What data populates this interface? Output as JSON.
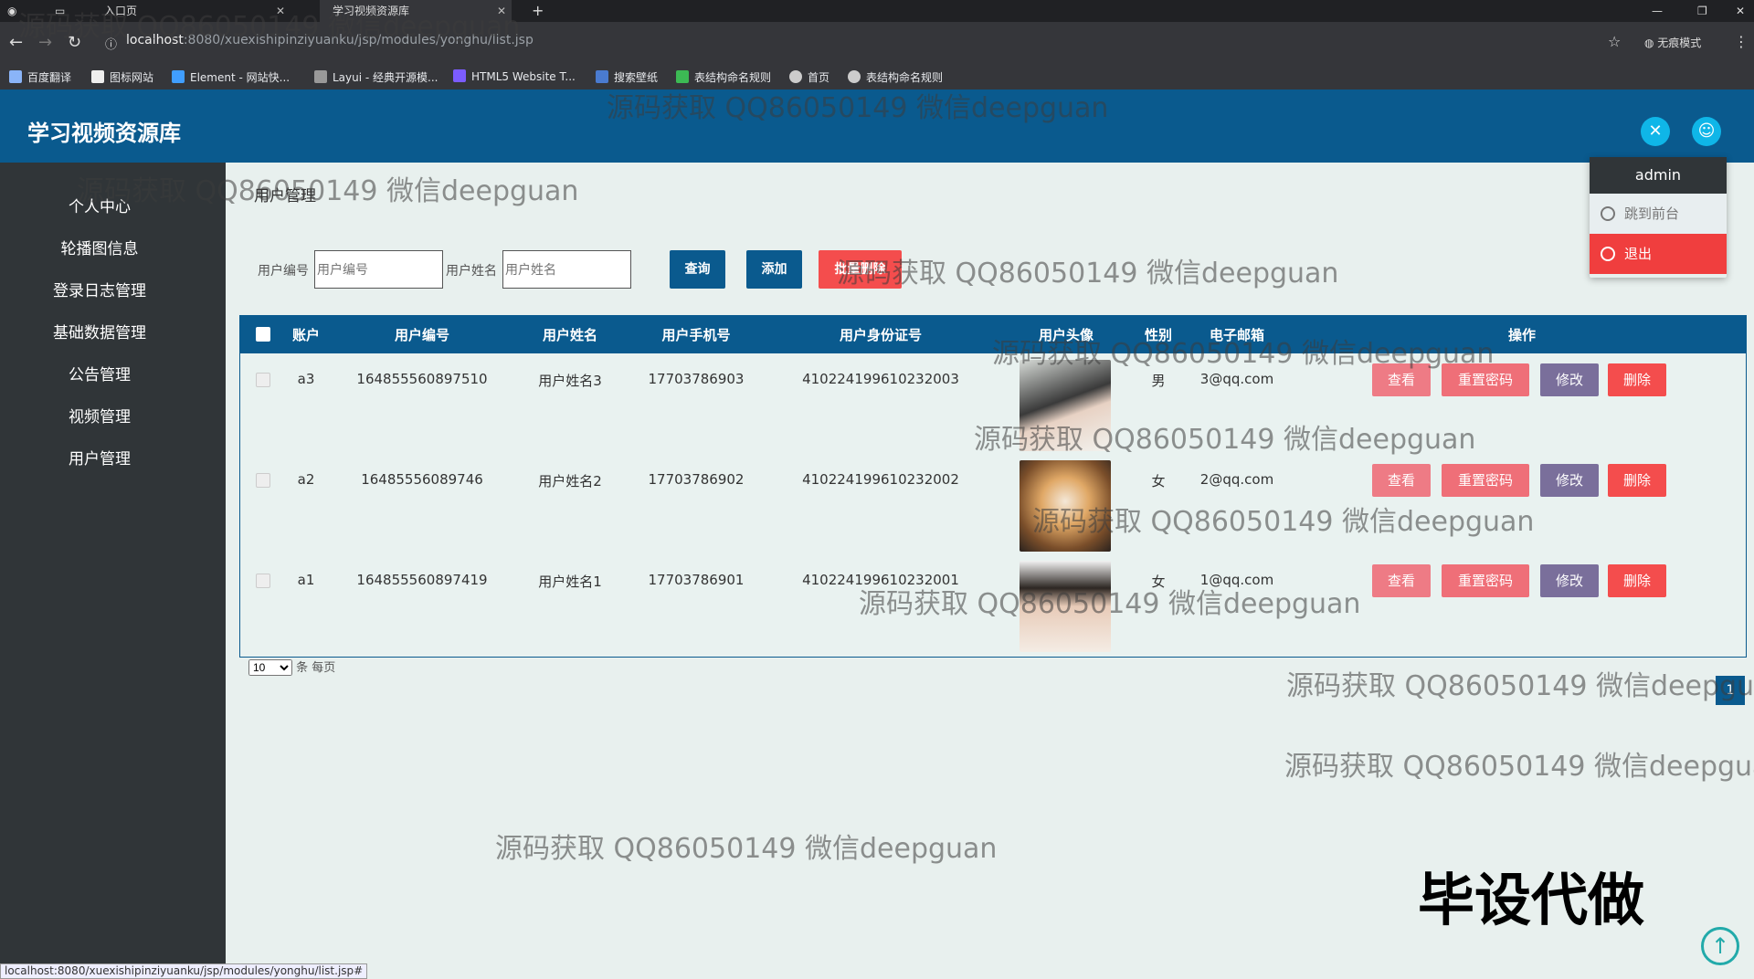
{
  "browser": {
    "tabs": [
      {
        "label": "入口页"
      },
      {
        "label": "学习视频资源库"
      }
    ],
    "new_tab": "+",
    "url_host": "localhost",
    "url_path": ":8080/xuexishipinziyuanku/jsp/modules/yonghu/list.jsp",
    "incognito_label": "无痕模式",
    "bookmarks": [
      "百度翻译",
      "图标网站",
      "Element - 网站快...",
      "Layui - 经典开源模...",
      "HTML5 Website T...",
      "搜索壁纸",
      "表结构命名规则",
      "首页",
      "表结构命名规则"
    ]
  },
  "header": {
    "title": "学习视频资源库"
  },
  "sidebar": {
    "items": [
      {
        "label": "个人中心"
      },
      {
        "label": "轮播图信息"
      },
      {
        "label": "登录日志管理"
      },
      {
        "label": "基础数据管理"
      },
      {
        "label": "公告管理"
      },
      {
        "label": "视频管理"
      },
      {
        "label": "用户管理"
      }
    ]
  },
  "page": {
    "breadcrumb": "用户管理"
  },
  "filter": {
    "user_no_label": "用户编号",
    "user_no_placeholder": "用户编号",
    "user_name_label": "用户姓名",
    "user_name_placeholder": "用户姓名",
    "query_button": "查询",
    "add_button": "添加",
    "batch_delete_button": "批量删除"
  },
  "table": {
    "headers": [
      "账户",
      "用户编号",
      "用户姓名",
      "用户手机号",
      "用户身份证号",
      "用户头像",
      "性别",
      "电子邮箱",
      "操作"
    ],
    "rows": [
      {
        "account": "a3",
        "user_no": "164855560897510",
        "name": "用户姓名3",
        "phone": "17703786903",
        "id_card": "410224199610232003",
        "gender": "男",
        "email": "3@qq.com"
      },
      {
        "account": "a2",
        "user_no": "16485556089746",
        "name": "用户姓名2",
        "phone": "17703786902",
        "id_card": "410224199610232002",
        "gender": "女",
        "email": "2@qq.com"
      },
      {
        "account": "a1",
        "user_no": "164855560897419",
        "name": "用户姓名1",
        "phone": "17703786901",
        "id_card": "410224199610232001",
        "gender": "女",
        "email": "1@qq.com"
      }
    ],
    "actions": {
      "view": "查看",
      "reset_password": "重置密码",
      "edit": "修改",
      "delete": "删除"
    }
  },
  "pager": {
    "page_size": "10",
    "per_page_text": "条 每页",
    "current_page": "1"
  },
  "user_menu": {
    "username": "admin",
    "to_front": "跳到前台",
    "logout": "退出"
  },
  "watermark": "源码获取 QQ86050149 微信deepguan",
  "badge": "毕设代做",
  "status_url": "localhost:8080/xuexishipinziyuanku/jsp/modules/yonghu/list.jsp#",
  "colors": {
    "primary": "#0a5a8e",
    "sidebar": "#303538",
    "danger": "#f44d4d",
    "accent": "#0fb6e8"
  }
}
